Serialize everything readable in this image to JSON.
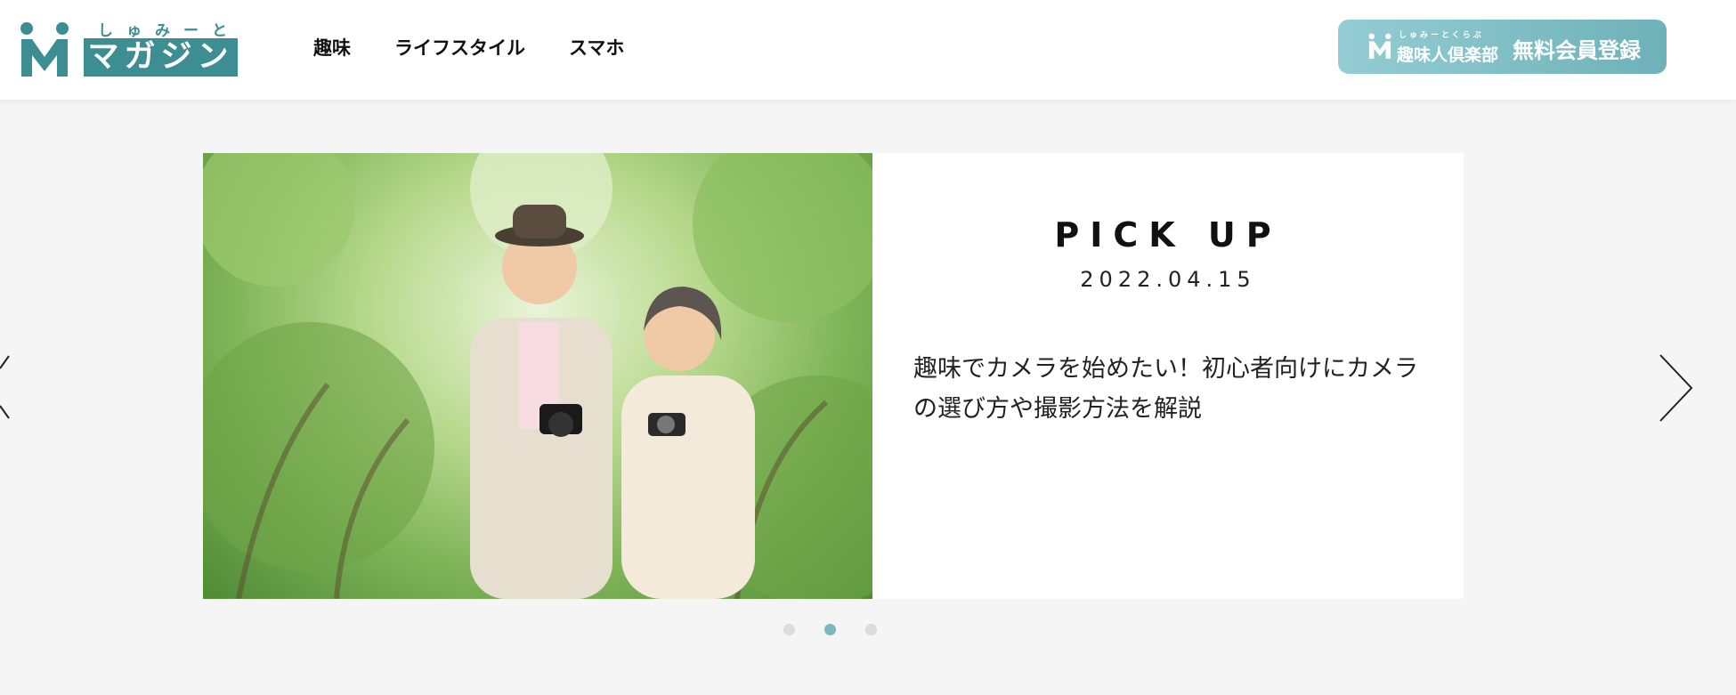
{
  "brand": {
    "ruby": "しゅみーと",
    "name": "マガジン",
    "accent": "#3d8e92"
  },
  "nav": {
    "items": [
      {
        "label": "趣味"
      },
      {
        "label": "ライフスタイル"
      },
      {
        "label": "スマホ"
      }
    ]
  },
  "signup_button": {
    "ruby": "しゅみーとくらぶ",
    "club": "趣味人倶楽部",
    "label": "無料会員登録",
    "gradient": [
      "#94cdd4",
      "#6eb1b8"
    ]
  },
  "carousel": {
    "slide": {
      "heading": "PICK UP",
      "date": "2022.04.15",
      "text": "趣味でカメラを始めたい！初心者向けにカメラの選び方や撮影方法を解説",
      "image_alt": "senior-couple-with-cameras-photo"
    },
    "active_index": 1,
    "dots": 3,
    "dot_active_color": "#7ab9be",
    "prev_icon": "chevron-left-icon",
    "next_icon": "chevron-right-icon"
  }
}
